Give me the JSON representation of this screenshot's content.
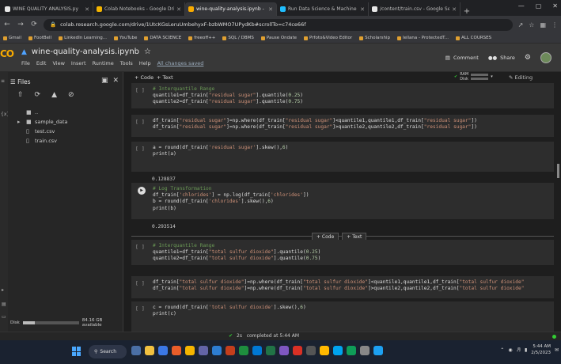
{
  "browser": {
    "tabs": [
      {
        "title": "WINE QUALITY ANALYSIS.py",
        "color": "#e8e8e8"
      },
      {
        "title": "Colab Notebooks - Google Dri",
        "color": "#f4b400"
      },
      {
        "title": "wine-quality-analysis.ipynb - Co",
        "color": "#f9ab00"
      },
      {
        "title": "Run Data Science & Machine Le",
        "color": "#20beff"
      },
      {
        "title": "/content/train.csv - Google Se",
        "color": "#e8e8e8"
      }
    ],
    "active_tab": 2,
    "new_tab_label": "+",
    "url": "colab.research.google.com/drive/1UtcKGsLeruUmbehyxF-bzbWMO7UPydKb#scrollTo=c74ce66f",
    "bookmarks": [
      "Gmail",
      "FootBell",
      "LinkedIn Learning...",
      "YouTube",
      "DATA SCIENCE",
      "freeoff++",
      "SQL / DBMS",
      "Pause Ondate",
      "Prfoto&Video Editor",
      "Scholarship",
      "Iellana - ProtectedT...",
      "ALL COURSES"
    ]
  },
  "colab": {
    "logo": "CO",
    "notebook_title": "wine-quality-analysis.ipynb",
    "menus": [
      "File",
      "Edit",
      "View",
      "Insert",
      "Runtime",
      "Tools",
      "Help"
    ],
    "save_status": "All changes saved",
    "comment_label": "Comment",
    "share_label": "Share",
    "add_code_label": "+ Code",
    "add_text_label": "+ Text",
    "ram_label": "RAM",
    "disk_label": "Disk",
    "editing_label": "Editing"
  },
  "sidebar": {
    "title": "Files",
    "tree": [
      {
        "name": "..",
        "kind": "folder",
        "indent": 0
      },
      {
        "name": "sample_data",
        "kind": "folder",
        "indent": 0
      },
      {
        "name": "test.csv",
        "kind": "file",
        "indent": 0
      },
      {
        "name": "train.csv",
        "kind": "file",
        "indent": 0
      }
    ],
    "disk_label": "Disk",
    "disk_text": "84.16 GB available",
    "disk_fraction": 0.22
  },
  "cells": [
    {
      "lines": [
        [
          {
            "t": "# Interquantile Range",
            "c": "cm"
          }
        ],
        [
          {
            "t": "quantile1=df_train[",
            "c": ""
          },
          {
            "t": "\"residual sugar\"",
            "c": "st"
          },
          {
            "t": "].quantile(",
            "c": ""
          },
          {
            "t": "0.25",
            "c": "nu"
          },
          {
            "t": ")",
            "c": ""
          }
        ],
        [
          {
            "t": "quantile2=df_train[",
            "c": ""
          },
          {
            "t": "\"residual sugar\"",
            "c": "st"
          },
          {
            "t": "].quantile(",
            "c": ""
          },
          {
            "t": "0.75",
            "c": "nu"
          },
          {
            "t": ")",
            "c": ""
          }
        ]
      ]
    },
    {
      "lines": [
        [
          {
            "t": "df_train[",
            "c": ""
          },
          {
            "t": "\"residual sugar\"",
            "c": "st"
          },
          {
            "t": "]=np.where(df_train[",
            "c": ""
          },
          {
            "t": "\"residual sugar\"",
            "c": "st"
          },
          {
            "t": "]<quantile1,quantile1,df_train[",
            "c": ""
          },
          {
            "t": "\"residual sugar\"",
            "c": "st"
          },
          {
            "t": "])",
            "c": ""
          }
        ],
        [
          {
            "t": "df_train[",
            "c": ""
          },
          {
            "t": "\"residual sugar\"",
            "c": "st"
          },
          {
            "t": "]=np.where(df_train[",
            "c": ""
          },
          {
            "t": "\"residual sugar\"",
            "c": "st"
          },
          {
            "t": "]>quantile2,quantile2,df_train[",
            "c": ""
          },
          {
            "t": "\"residual sugar\"",
            "c": "st"
          },
          {
            "t": "])",
            "c": ""
          }
        ]
      ]
    },
    {
      "lines": [
        [
          {
            "t": "a = round(df_train[",
            "c": ""
          },
          {
            "t": "'residual sugar'",
            "c": "st"
          },
          {
            "t": "].skew(),",
            "c": ""
          },
          {
            "t": "6",
            "c": "nu"
          },
          {
            "t": ")",
            "c": ""
          }
        ],
        [
          {
            "t": "print(a)",
            "c": ""
          }
        ]
      ],
      "output": "0.128837"
    },
    {
      "lines": [
        [
          {
            "t": "# Log Transformation",
            "c": "cm"
          }
        ],
        [
          {
            "t": "df_train[",
            "c": ""
          },
          {
            "t": "'chlorides'",
            "c": "st"
          },
          {
            "t": "] = np.log(df_train[",
            "c": ""
          },
          {
            "t": "'chlorides'",
            "c": "st"
          },
          {
            "t": "])",
            "c": ""
          }
        ],
        [
          {
            "t": "b = round(df_train[",
            "c": ""
          },
          {
            "t": "'chlorides'",
            "c": "st"
          },
          {
            "t": "].skew(),",
            "c": ""
          },
          {
            "t": "6",
            "c": "nu"
          },
          {
            "t": ")",
            "c": ""
          }
        ],
        [
          {
            "t": "print(b)",
            "c": ""
          }
        ]
      ],
      "output": "0.293514"
    },
    {
      "lines": [
        [
          {
            "t": "# Interquantile Range",
            "c": "cm"
          }
        ],
        [
          {
            "t": "quantile1=df_train[",
            "c": ""
          },
          {
            "t": "\"total sulfur dioxide\"",
            "c": "st"
          },
          {
            "t": "].quantile(",
            "c": ""
          },
          {
            "t": "0.25",
            "c": "nu"
          },
          {
            "t": ")",
            "c": ""
          }
        ],
        [
          {
            "t": "quantile2=df_train[",
            "c": ""
          },
          {
            "t": "\"total sulfur dioxide\"",
            "c": "st"
          },
          {
            "t": "].quantile(",
            "c": ""
          },
          {
            "t": "0.75",
            "c": "nu"
          },
          {
            "t": ")",
            "c": ""
          }
        ]
      ]
    },
    {
      "lines": [
        [
          {
            "t": "df_train[",
            "c": ""
          },
          {
            "t": "\"total sulfur dioxide\"",
            "c": "st"
          },
          {
            "t": "]=np.where(df_train[",
            "c": ""
          },
          {
            "t": "\"total sulfur dioxide\"",
            "c": "st"
          },
          {
            "t": "]<quantile1,quantile1,df_train[",
            "c": ""
          },
          {
            "t": "\"total sulfur dioxide\"",
            "c": "st"
          }
        ],
        [
          {
            "t": "df_train[",
            "c": ""
          },
          {
            "t": "\"total sulfur dioxide\"",
            "c": "st"
          },
          {
            "t": "]=np.where(df_train[",
            "c": ""
          },
          {
            "t": "\"total sulfur dioxide\"",
            "c": "st"
          },
          {
            "t": "]>quantile2,quantile2,df_train[",
            "c": ""
          },
          {
            "t": "\"total sulfur dioxide\"",
            "c": "st"
          }
        ]
      ]
    },
    {
      "lines": [
        [
          {
            "t": "c = round(df_train[",
            "c": ""
          },
          {
            "t": "'total sulfur dioxide'",
            "c": "st"
          },
          {
            "t": "].skew(),",
            "c": ""
          },
          {
            "t": "6",
            "c": "nu"
          },
          {
            "t": ")",
            "c": ""
          }
        ],
        [
          {
            "t": "print(c)",
            "c": ""
          }
        ]
      ]
    }
  ],
  "run_button_label": "[ ]",
  "status": {
    "elapsed": "2s",
    "text": "completed at 5:44 AM"
  },
  "taskbar": {
    "search_label": "Search",
    "time": "5:44 AM",
    "date": "2/5/2023",
    "icon_colors": [
      "#4a6fa5",
      "#f0c040",
      "#3b78e7",
      "#e85d2a",
      "#f4b400",
      "#6264a7",
      "#2d7dd2",
      "#c43e1c",
      "#1e8e3e",
      "#0078d4",
      "#217346",
      "#7e57c2",
      "#d93025",
      "#555555",
      "#ffb900",
      "#00a4ef",
      "#0f9d58",
      "#888888",
      "#1da1f2"
    ]
  }
}
